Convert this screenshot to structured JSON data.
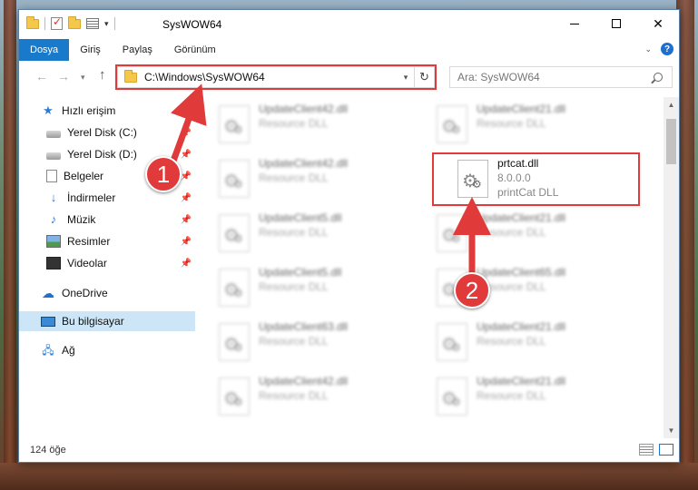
{
  "window": {
    "title": "SysWOW64"
  },
  "ribbon": {
    "tabs": [
      "Dosya",
      "Giriş",
      "Paylaş",
      "Görünüm"
    ]
  },
  "address": {
    "path": "C:\\Windows\\SysWOW64"
  },
  "search": {
    "placeholder": "Ara: SysWOW64"
  },
  "sidebar": {
    "items": [
      {
        "label": "Hızlı erişim",
        "icon": "star-icon"
      },
      {
        "label": "Yerel Disk (C:)",
        "icon": "drive-icon",
        "pinned": true
      },
      {
        "label": "Yerel Disk (D:)",
        "icon": "drive-icon",
        "pinned": true
      },
      {
        "label": "Belgeler",
        "icon": "documents-icon",
        "pinned": true
      },
      {
        "label": "İndirmeler",
        "icon": "downloads-icon",
        "pinned": true
      },
      {
        "label": "Müzik",
        "icon": "music-icon",
        "pinned": true
      },
      {
        "label": "Resimler",
        "icon": "pictures-icon",
        "pinned": true
      },
      {
        "label": "Videolar",
        "icon": "videos-icon",
        "pinned": true
      },
      {
        "label": "OneDrive",
        "icon": "cloud-icon"
      },
      {
        "label": "Bu bilgisayar",
        "icon": "computer-icon",
        "selected": true
      },
      {
        "label": "Ağ",
        "icon": "network-icon"
      }
    ]
  },
  "files": [
    {
      "name": "UpdateClient42.dll",
      "type": "Resource DLL"
    },
    {
      "name": "UpdateClient21.dll",
      "type": "Resource DLL"
    },
    {
      "name": "UpdateClient42.dll",
      "type": "Resource DLL"
    },
    {
      "name": "prtcat.dll",
      "version": "8.0.0.0",
      "type": "printCat DLL",
      "highlighted": true
    },
    {
      "name": "UpdateClient5.dll",
      "type": "Resource DLL"
    },
    {
      "name": "UpdateClient21.dll",
      "type": "Resource DLL"
    },
    {
      "name": "UpdateClient5.dll",
      "type": "Resource DLL"
    },
    {
      "name": "UpdateClient65.dll",
      "type": "Resource DLL"
    },
    {
      "name": "UpdateClient63.dll",
      "type": "Resource DLL"
    },
    {
      "name": "UpdateClient21.dll",
      "type": "Resource DLL"
    },
    {
      "name": "UpdateClient42.dll",
      "type": "Resource DLL"
    },
    {
      "name": "UpdateClient21.dll",
      "type": "Resource DLL"
    }
  ],
  "status": {
    "item_count": "124 öğe"
  },
  "callouts": [
    "1",
    "2"
  ],
  "colors": {
    "accent": "#1979ca",
    "highlight": "#e03a3a",
    "selected": "#cde6f7"
  }
}
